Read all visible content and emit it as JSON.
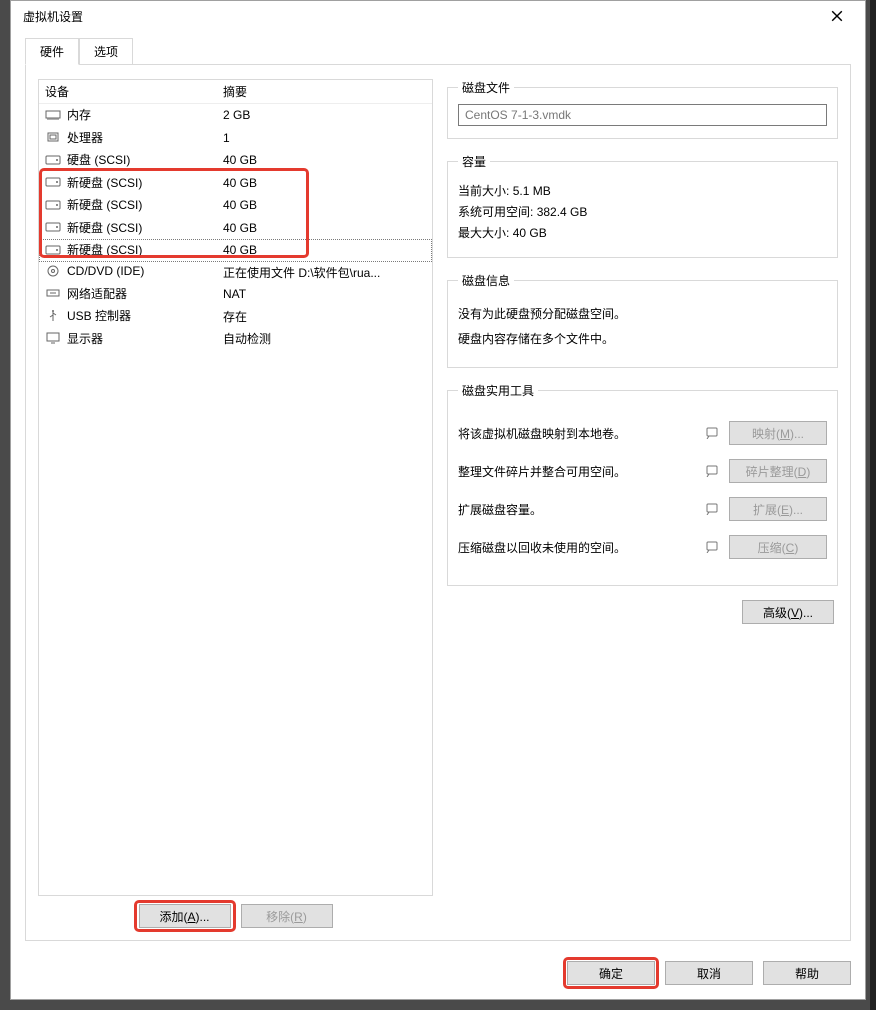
{
  "window": {
    "title": "虚拟机设置"
  },
  "tabs": {
    "hardware": "硬件",
    "options": "选项"
  },
  "device_table": {
    "col_device": "设备",
    "col_summary": "摘要",
    "rows": [
      {
        "icon": "memory",
        "name": "内存",
        "summary": "2 GB"
      },
      {
        "icon": "cpu",
        "name": "处理器",
        "summary": "1"
      },
      {
        "icon": "hdd",
        "name": "硬盘 (SCSI)",
        "summary": "40 GB"
      },
      {
        "icon": "hdd",
        "name": "新硬盘 (SCSI)",
        "summary": "40 GB"
      },
      {
        "icon": "hdd",
        "name": "新硬盘 (SCSI)",
        "summary": "40 GB"
      },
      {
        "icon": "hdd",
        "name": "新硬盘 (SCSI)",
        "summary": "40 GB"
      },
      {
        "icon": "hdd",
        "name": "新硬盘 (SCSI)",
        "summary": "40 GB",
        "selected": true
      },
      {
        "icon": "cd",
        "name": "CD/DVD (IDE)",
        "summary": "正在使用文件 D:\\软件包\\rua..."
      },
      {
        "icon": "net",
        "name": "网络适配器",
        "summary": "NAT"
      },
      {
        "icon": "usb",
        "name": "USB 控制器",
        "summary": "存在"
      },
      {
        "icon": "display",
        "name": "显示器",
        "summary": "自动检测"
      }
    ]
  },
  "left_buttons": {
    "add": "添加(A)...",
    "remove": "移除(R)"
  },
  "right": {
    "disk_file": {
      "legend": "磁盘文件",
      "value": "CentOS 7-1-3.vmdk"
    },
    "capacity": {
      "legend": "容量",
      "current_label": "当前大小:",
      "current_value": "5.1 MB",
      "free_label": "系统可用空间:",
      "free_value": "382.4 GB",
      "max_label": "最大大小:",
      "max_value": "40 GB"
    },
    "disk_info": {
      "legend": "磁盘信息",
      "line1": "没有为此硬盘预分配磁盘空间。",
      "line2": "硬盘内容存储在多个文件中。"
    },
    "tools": {
      "legend": "磁盘实用工具",
      "map_desc": "将该虚拟机磁盘映射到本地卷。",
      "map_btn": "映射(M)...",
      "defrag_desc": "整理文件碎片并整合可用空间。",
      "defrag_btn": "碎片整理(D)",
      "expand_desc": "扩展磁盘容量。",
      "expand_btn": "扩展(E)...",
      "compact_desc": "压缩磁盘以回收未使用的空间。",
      "compact_btn": "压缩(C)"
    },
    "advanced_btn": "高级(V)..."
  },
  "dialog_buttons": {
    "ok": "确定",
    "cancel": "取消",
    "help": "帮助"
  }
}
